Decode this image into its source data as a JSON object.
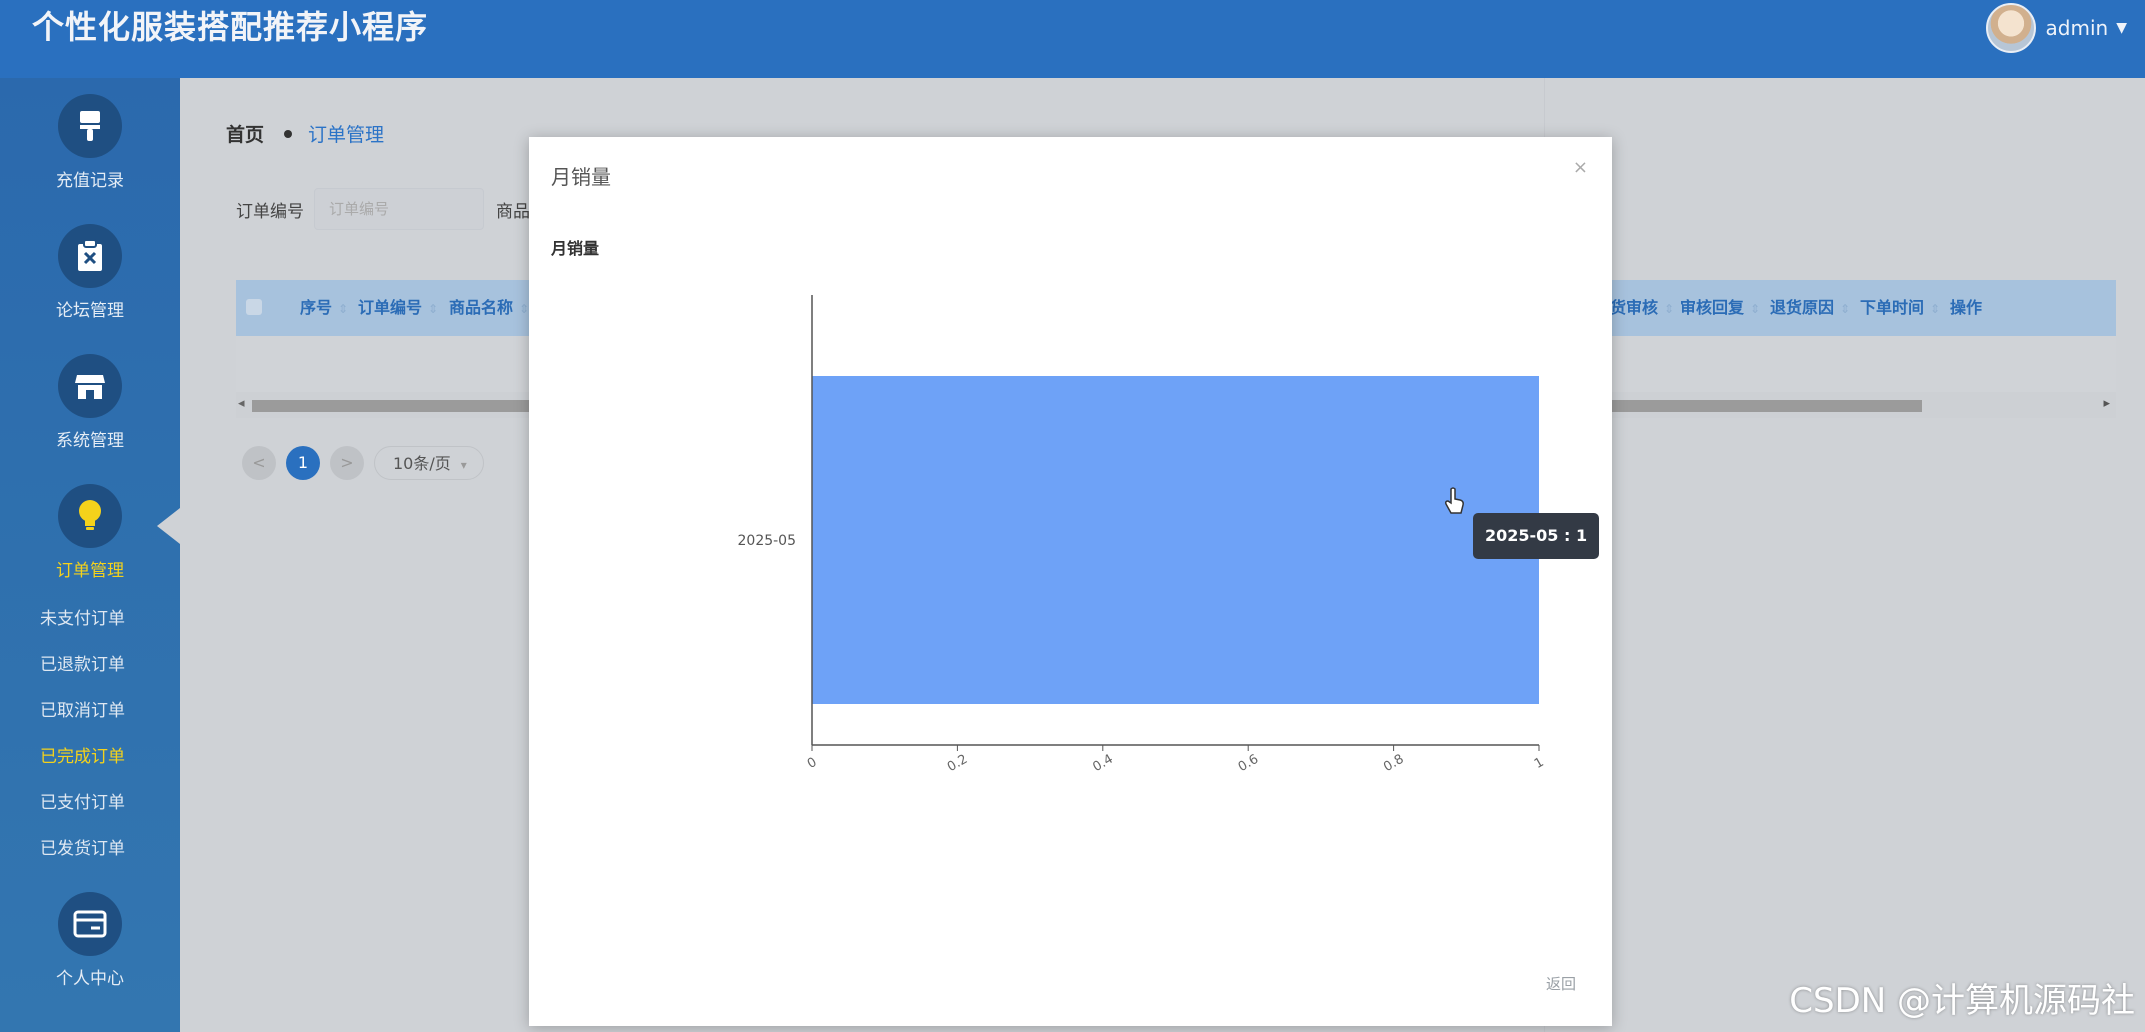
{
  "app": {
    "title": "个性化服装搭配推荐小程序"
  },
  "user": {
    "name": "admin"
  },
  "sidebar": {
    "items": [
      {
        "label": "充值记录",
        "icon": "brush-icon"
      },
      {
        "label": "论坛管理",
        "icon": "clipboard-x-icon"
      },
      {
        "label": "系统管理",
        "icon": "store-icon"
      },
      {
        "label": "订单管理",
        "icon": "lightbulb-icon",
        "active": true
      },
      {
        "label": "个人中心",
        "icon": "card-icon"
      }
    ],
    "submenu": [
      {
        "label": "未支付订单"
      },
      {
        "label": "已退款订单"
      },
      {
        "label": "已取消订单"
      },
      {
        "label": "已完成订单",
        "active": true
      },
      {
        "label": "已支付订单"
      },
      {
        "label": "已发货订单"
      }
    ]
  },
  "breadcrumb": {
    "home": "首页",
    "current": "订单管理"
  },
  "search": {
    "order_no_label": "订单编号",
    "order_no_placeholder": "订单编号",
    "product_label": "商品"
  },
  "table": {
    "headers_left": [
      "序号",
      "订单编号",
      "商品名称"
    ],
    "headers_right": [
      "货审核",
      "审核回复",
      "退货原因",
      "下单时间",
      "操作"
    ]
  },
  "pagination": {
    "prev": "<",
    "current": "1",
    "next": ">",
    "page_size": "10条/页"
  },
  "modal": {
    "title": "月销量",
    "close": "×",
    "chart_title": "月销量",
    "back_label": "返回",
    "tooltip": "2025-05 : 1"
  },
  "chart_data": {
    "type": "bar",
    "orientation": "horizontal",
    "title": "月销量",
    "categories": [
      "2025-05"
    ],
    "series": [
      {
        "values": [
          1
        ]
      }
    ],
    "xlim": [
      0,
      1
    ],
    "xticks": [
      "0",
      "0.2",
      "0.4",
      "0.6",
      "0.8",
      "1"
    ],
    "bar_color": "#6ea2f7",
    "grid": false
  },
  "watermark": "CSDN @计算机源码社",
  "colors": {
    "header": "#2a70bf",
    "sidebar": "#2e6fae",
    "accent": "#2b73c7",
    "active": "#f4d21b"
  }
}
